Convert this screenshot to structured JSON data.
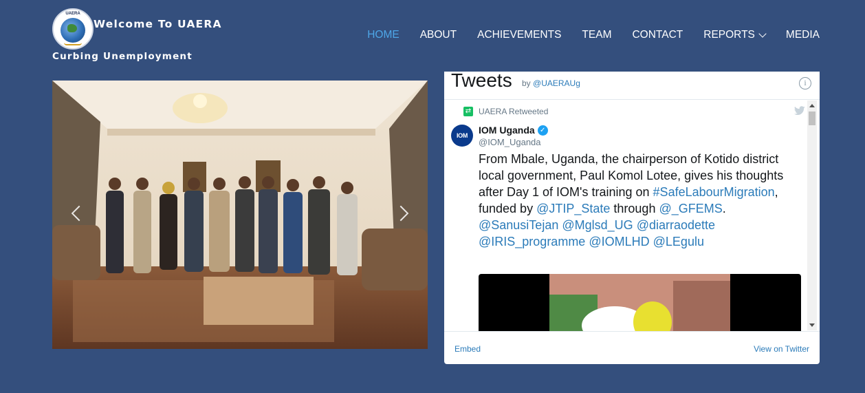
{
  "header": {
    "welcome": "Welcome To UAERA",
    "tagline": "Curbing Unemployment",
    "logo_text": "UAERA"
  },
  "nav": {
    "items": [
      {
        "label": "HOME",
        "active": true
      },
      {
        "label": "ABOUT"
      },
      {
        "label": "ACHIEVEMENTS"
      },
      {
        "label": "TEAM"
      },
      {
        "label": "CONTACT"
      },
      {
        "label": "REPORTS",
        "dropdown": true
      },
      {
        "label": "MEDIA"
      }
    ]
  },
  "twitter": {
    "title": "Tweets",
    "by_prefix": "by",
    "by_handle": "@UAERAUg",
    "info_icon": "info-icon",
    "retweet_label": "UAERA Retweeted",
    "author_name": "IOM Uganda",
    "author_handle": "@IOM_Uganda",
    "avatar_text": "IOM",
    "tweet": {
      "t1": "From Mbale, Uganda, the chairperson of Kotido district local government, Paul Komol Lotee, gives his thoughts after Day 1 of IOM's training on ",
      "hashtag": "#SafeLabourMigration",
      "t2": ", funded by ",
      "m1": "@JTIP_State",
      "t3": " through ",
      "m2": "@_GFEMS",
      "t4": ".",
      "m3": "@SanusiTejan",
      "m4": "@Mglsd_UG",
      "m5": "@diarraodette",
      "m6": "@IRIS_programme",
      "m7": "@IOMLHD",
      "m8": "@LEgulu"
    },
    "embed": "Embed",
    "view_on_twitter": "View on Twitter"
  },
  "colors": {
    "background": "#344f7d",
    "nav_active": "#4ea7e8",
    "link": "#2b7bb9"
  }
}
